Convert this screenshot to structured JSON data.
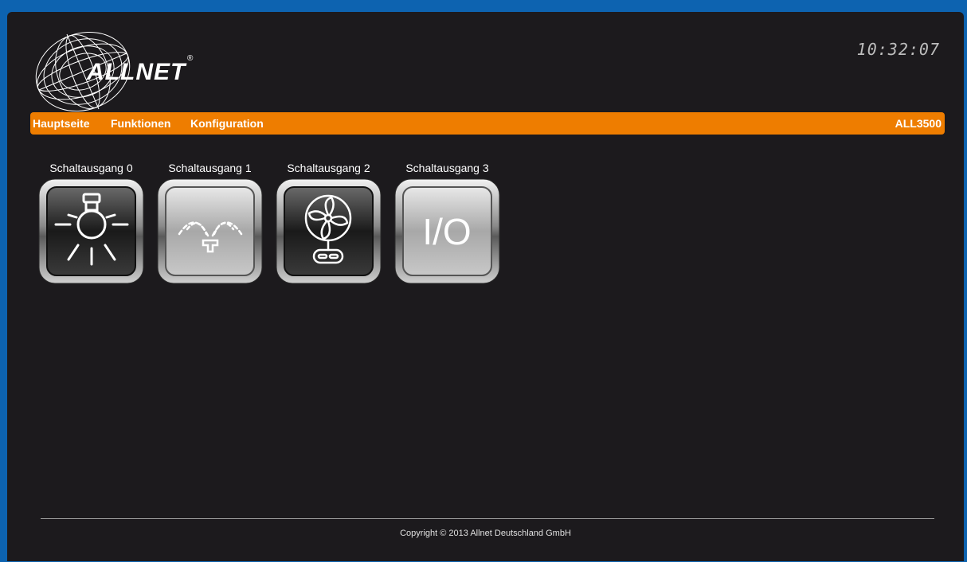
{
  "header": {
    "logo_text": "ALLNET",
    "logo_mark": "®",
    "clock": "10:32:07"
  },
  "nav": {
    "items": [
      {
        "label": "Hauptseite"
      },
      {
        "label": "Funktionen"
      },
      {
        "label": "Konfiguration"
      }
    ],
    "model": "ALL3500",
    "color": "#ee7d00"
  },
  "outputs": [
    {
      "label": "Schaltausgang 0",
      "icon": "light-bulb-icon",
      "state": "off"
    },
    {
      "label": "Schaltausgang 1",
      "icon": "sprinkler-icon",
      "state": "on"
    },
    {
      "label": "Schaltausgang 2",
      "icon": "fan-icon",
      "state": "off"
    },
    {
      "label": "Schaltausgang 3",
      "icon": "io-icon",
      "state": "on",
      "icon_text": "I/O"
    }
  ],
  "footer": {
    "copyright": "Copyright © 2013 Allnet Deutschland GmbH"
  }
}
